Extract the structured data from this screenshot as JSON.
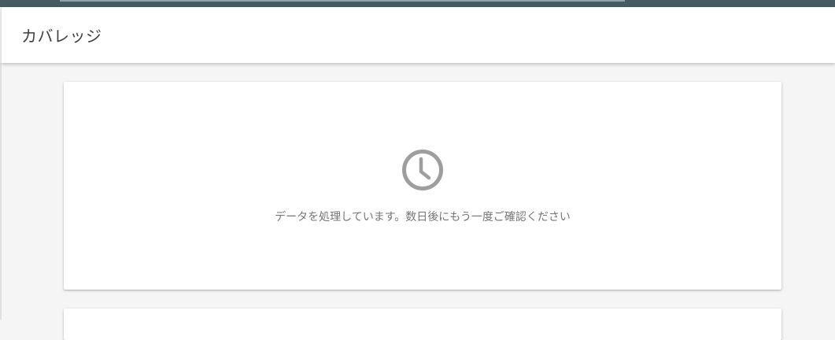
{
  "header": {
    "title": "カバレッジ"
  },
  "status": {
    "message": "データを処理しています。数日後にもう一度ご確認ください",
    "icon": "clock-icon"
  },
  "colors": {
    "top_bar": "#455a64",
    "icon": "#9e9e9e",
    "message_text": "#757575",
    "title_text": "#3c4043",
    "background": "#f5f5f5"
  }
}
